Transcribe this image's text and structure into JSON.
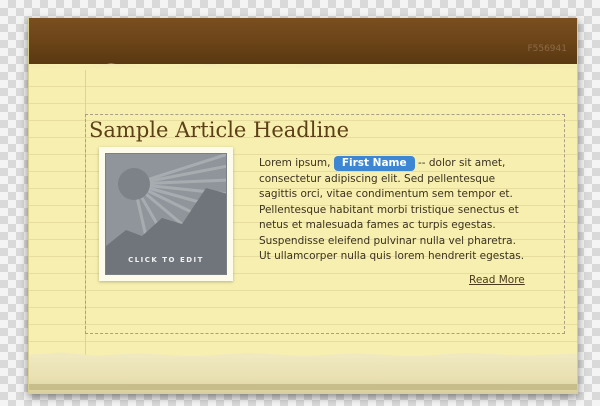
{
  "header": {
    "code": "F556941"
  },
  "article": {
    "headline": "Sample Article Headline",
    "image_label": "CLICK TO EDIT",
    "body_before_tag": "Lorem ipsum, ",
    "tag": "First Name",
    "body_after_tag": " -- dolor sit amet, consectetur adipiscing elit. Sed pellentesque sagittis orci, vitae condimentum sem tempor et. Pellentesque habitant morbi tristique senectus et netus et malesuada fames ac turpis egestas. Suspendisse eleifend pulvinar nulla vel pharetra. Ut ullamcorper nulla quis lorem hendrerit egestas.",
    "read_more": "Read More"
  },
  "colors": {
    "header_brown": "#6a4317",
    "paper_yellow": "#f7efaf",
    "headline": "#5c3f17",
    "tag_blue": "#3c86d4"
  }
}
